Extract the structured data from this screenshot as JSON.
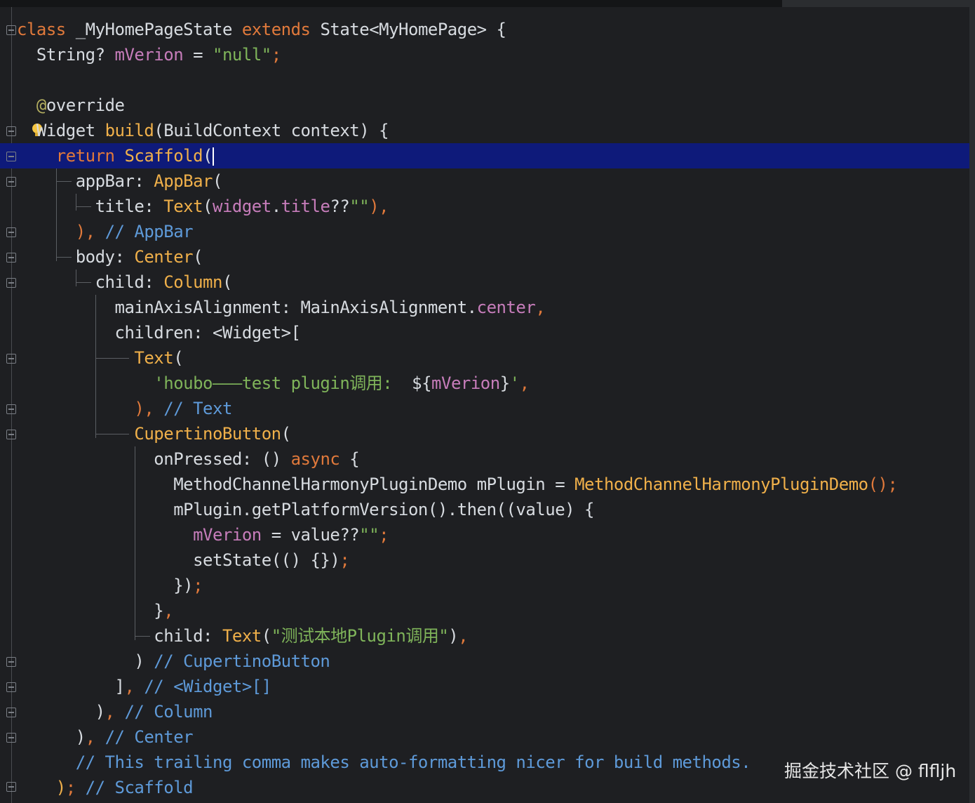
{
  "code_lines": [
    "class _MyHomePageState extends State<MyHomePage> {",
    "  String? mVerion = \"null\";",
    "",
    "  @override",
    "  Widget build(BuildContext context) {",
    "    return Scaffold(",
    "      appBar: AppBar(",
    "        title: Text(widget.title??\"\"),",
    "      ), // AppBar",
    "      body: Center(",
    "        child: Column(",
    "          mainAxisAlignment: MainAxisAlignment.center,",
    "          children: <Widget>[",
    "            Text(",
    "              'houbo———test plugin调用:  ${mVerion}',",
    "            ), // Text",
    "            CupertinoButton(",
    "              onPressed: () async {",
    "                MethodChannelHarmonyPluginDemo mPlugin = MethodChannelHarmonyPluginDemo();",
    "                mPlugin.getPlatformVersion().then((value) {",
    "                  mVerion = value??\"\";",
    "                  setState(() {});",
    "                });",
    "              },",
    "              child: Text(\"测试本地Plugin调用\"),",
    "            ) // CupertinoButton",
    "          ], // <Widget>[]",
    "        ), // Column",
    "      ), // Center",
    "      // This trailing comma makes auto-formatting nicer for build methods.",
    "    ); // Scaffold"
  ],
  "tokens": {
    "l0": [
      "class",
      " _MyHomePageState ",
      "extends",
      " State<MyHomePage> {"
    ],
    "l1": [
      "String? ",
      "mVerion",
      " = ",
      "\"null\"",
      ";"
    ],
    "l3": [
      "@",
      "override"
    ],
    "l4": [
      "Widget ",
      "build",
      "(BuildContext context) {"
    ],
    "l5": [
      "return ",
      "Scaffold",
      "("
    ],
    "l6": [
      "appBar: ",
      "AppBar",
      "("
    ],
    "l7": [
      "title: ",
      "Text",
      "(",
      "widget",
      ".",
      "title",
      "??",
      "\"\"",
      "),"
    ],
    "l8": [
      "), ",
      "// AppBar"
    ],
    "l9": [
      "body: ",
      "Center",
      "("
    ],
    "l10": [
      "child: ",
      "Column",
      "("
    ],
    "l11": [
      "mainAxisAlignment: MainAxisAlignment.",
      "center",
      ","
    ],
    "l12": [
      "children: <Widget>["
    ],
    "l13": [
      "Text",
      "("
    ],
    "l14": [
      "'houbo———test plugin调用:  ",
      "${",
      "mVerion",
      "}",
      "'",
      ","
    ],
    "l15": [
      "), ",
      "// Text"
    ],
    "l16": [
      "CupertinoButton",
      "("
    ],
    "l17": [
      "onPressed: () ",
      "async",
      " {"
    ],
    "l18": [
      "MethodChannelHarmonyPluginDemo mPlugin = ",
      "MethodChannelHarmonyPluginDemo",
      "();"
    ],
    "l19": [
      "mPlugin.getPlatformVersion().then((value) {"
    ],
    "l20": [
      "mVerion",
      " = value??",
      "\"\"",
      ";"
    ],
    "l21": [
      "setState(() {})",
      ";"
    ],
    "l22": [
      "})",
      ";"
    ],
    "l23": [
      "}",
      ","
    ],
    "l24": [
      "child: ",
      "Text",
      "(",
      "\"测试本地Plugin调用\"",
      ")",
      ","
    ],
    "l25": [
      ") ",
      "// CupertinoButton"
    ],
    "l26": [
      "]",
      ", ",
      "// <Widget>[]"
    ],
    "l27": [
      ")",
      ", ",
      "// Column"
    ],
    "l28": [
      ")",
      ", ",
      "// Center"
    ],
    "l29": [
      "// This trailing comma makes auto-formatting nicer for build methods."
    ],
    "l30": [
      ")",
      "; ",
      "// Scaffold"
    ]
  },
  "colors": {
    "keyword": "#e0793b",
    "function": "#f0b04a",
    "string": "#7fb45a",
    "field": "#c77dbb",
    "comment": "#5e9ad9",
    "annotation": "#b3ae60",
    "current_line_highlight": "#0e1a7a",
    "background": "#1e1f22"
  },
  "current_line": 6,
  "icons": {
    "fold_marker": "fold-marker-icon",
    "intention": "lightbulb-icon"
  },
  "watermark": "掘金技术社区 @ flfljh"
}
